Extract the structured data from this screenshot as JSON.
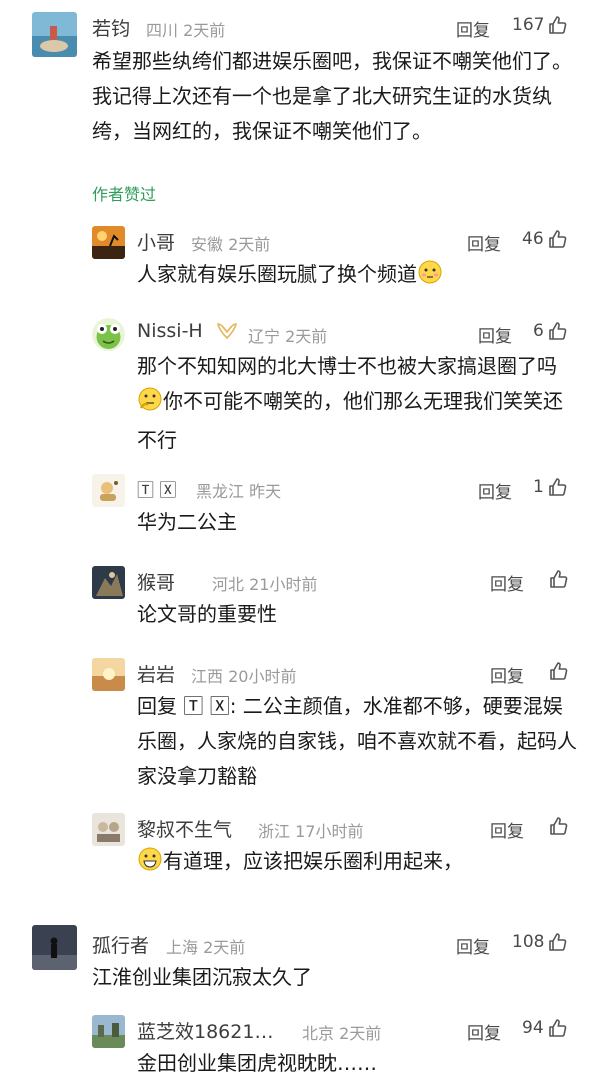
{
  "comments": [
    {
      "name": "若钧",
      "meta": "四川 2天前",
      "reply": "回复",
      "likes": "167",
      "content": "希望那些纨绔们都进娱乐圈吧，我保证不嘲笑他们了。我记得上次还有一个也是拿了北大研究生证的水货纨绔，当网红的，我保证不嘲笑他们了。",
      "author_liked": "作者赞过",
      "replies": [
        {
          "name": "小哥",
          "meta": "安徽 2天前",
          "reply": "回复",
          "likes": "46",
          "content": "人家就有娱乐圈玩腻了换个频道"
        },
        {
          "name": "Nissi-H",
          "meta": "辽宁 2天前",
          "reply": "回复",
          "likes": "6",
          "content_a": "那个不知知网的北大博士不也被大家搞退圈了吗",
          "content_b": "你不可能不嘲笑的，他们那么无理我们笑笑还不行"
        },
        {
          "name": "🅃 🅇",
          "meta": "黑龙江 昨天",
          "reply": "回复",
          "likes": "1",
          "content": "华为二公主"
        },
        {
          "name": "猴哥",
          "meta": "河北 21小时前",
          "reply": "回复",
          "likes": "",
          "content": "论文哥的重要性"
        },
        {
          "name": "岩岩",
          "meta": "江西 20小时前",
          "reply": "回复",
          "likes": "",
          "content": "回复 🅃 🅇: 二公主颜值，水准都不够，硬要混娱乐圈，人家烧的自家钱，咱不喜欢就不看，起码人家没拿刀豁豁"
        },
        {
          "name": "黎叔不生气",
          "meta": "浙江 17小时前",
          "reply": "回复",
          "likes": "",
          "content": "有道理，应该把娱乐圈利用起来，"
        }
      ]
    },
    {
      "name": "孤行者",
      "meta": "上海 2天前",
      "reply": "回复",
      "likes": "108",
      "content": "江淮创业集团沉寂太久了",
      "replies": [
        {
          "name": "蓝芝效18621…",
          "meta": "北京 2天前",
          "reply": "回复",
          "likes": "94",
          "content": "金田创业集团虎视眈眈……"
        }
      ]
    }
  ],
  "colors": {
    "author_liked": "#2e9c5c",
    "meta": "#9a9a9a",
    "name": "#3d3d3d"
  },
  "icons": {
    "like": "thumbs-up-icon"
  }
}
